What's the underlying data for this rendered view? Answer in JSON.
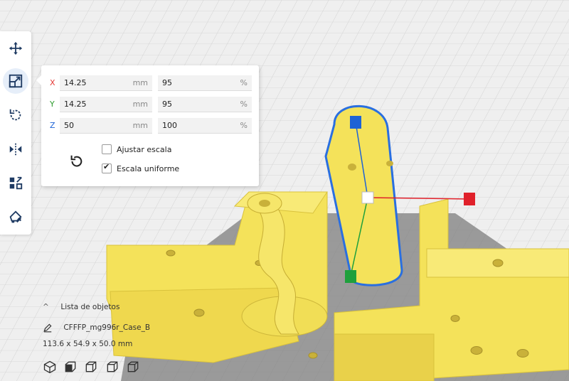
{
  "toolbar": {
    "tools": [
      {
        "icon": "move-icon"
      },
      {
        "icon": "scale-icon",
        "active": true
      },
      {
        "icon": "rotate-icon"
      },
      {
        "icon": "mirror-icon"
      },
      {
        "icon": "per-model-settings-icon"
      },
      {
        "icon": "support-blocker-icon"
      }
    ]
  },
  "scale_panel": {
    "rows": [
      {
        "axis": "X",
        "mm": "14.25",
        "mm_unit": "mm",
        "pct": "95",
        "pct_unit": "%",
        "color": "#e53935"
      },
      {
        "axis": "Y",
        "mm": "14.25",
        "mm_unit": "mm",
        "pct": "95",
        "pct_unit": "%",
        "color": "#2e9b2e"
      },
      {
        "axis": "Z",
        "mm": "50",
        "mm_unit": "mm",
        "pct": "100",
        "pct_unit": "%",
        "color": "#1e63d6"
      }
    ],
    "snap_scaling_label": "Ajustar escala",
    "snap_scaling_checked": false,
    "uniform_scaling_label": "Escala uniforme",
    "uniform_scaling_checked": true,
    "reset_icon": "reset-icon"
  },
  "object_list": {
    "header": "Lista de objetos",
    "object_name": "CFFFP_mg996r_Case_B",
    "dimensions": "113.6 x 54.9 x 50.0 mm"
  },
  "view_buttons": [
    "3d-view-icon",
    "front-view-icon",
    "top-view-icon",
    "left-view-icon",
    "right-view-icon"
  ],
  "colors": {
    "model_yellow": "#f5e35c",
    "selection_outline": "#2a6fe0",
    "gizmo_x": "#e0202a",
    "gizmo_y": "#1ea03c",
    "gizmo_z": "#1e63d6"
  }
}
